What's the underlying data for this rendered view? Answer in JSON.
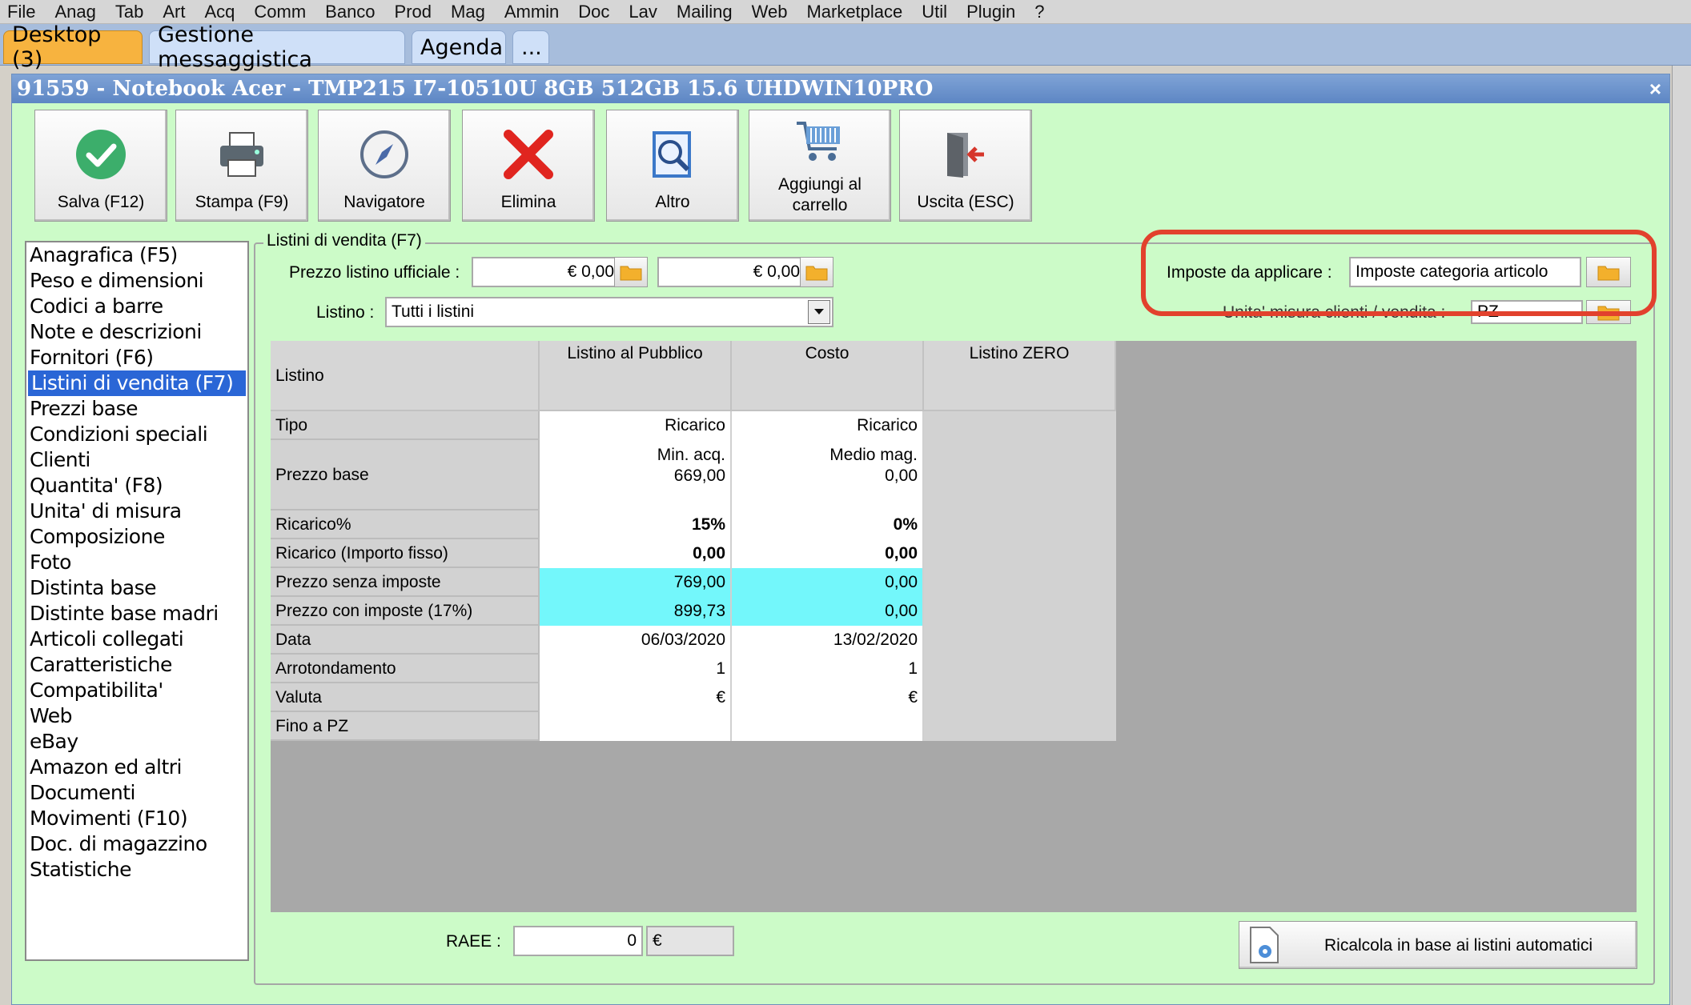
{
  "menu": [
    "File",
    "Anag",
    "Tab",
    "Art",
    "Acq",
    "Comm",
    "Banco",
    "Prod",
    "Mag",
    "Ammin",
    "Doc",
    "Lav",
    "Mailing",
    "Web",
    "Marketplace",
    "Util",
    "Plugin",
    "?"
  ],
  "tabs": [
    "Desktop (3)",
    "Gestione messaggistica",
    "Agenda",
    "..."
  ],
  "window": {
    "title": "91559 - Notebook Acer - TMP215 I7-10510U 8GB 512GB 15.6 UHDWIN10PRO",
    "close": "×"
  },
  "toolbar": {
    "save": "Salva (F12)",
    "print": "Stampa (F9)",
    "navigator": "Navigatore",
    "delete": "Elimina",
    "other": "Altro",
    "cart_line1": "Aggiungi al",
    "cart_line2": "carrello",
    "exit": "Uscita (ESC)"
  },
  "nav": [
    "Anagrafica (F5)",
    "Peso e dimensioni",
    "Codici a barre",
    "Note e descrizioni",
    "Fornitori (F6)",
    "Listini di vendita (F7)",
    "Prezzi base",
    "Condizioni speciali",
    "Clienti",
    "Quantita' (F8)",
    "Unita' di misura",
    "Composizione",
    "Foto",
    "Distinta base",
    "Distinte base madri",
    "Articoli collegati",
    "Caratteristiche",
    "Compatibilita'",
    "Web",
    "eBay",
    "Amazon ed altri",
    "Documenti",
    "Movimenti (F10)",
    "Doc. di magazzino",
    "Statistiche"
  ],
  "nav_selected": "Listini di vendita (F7)",
  "form": {
    "legend": "Listini di vendita (F7)",
    "official_price_label": "Prezzo listino ufficiale :",
    "official_price_1": "€ 0,00",
    "official_price_2": "€ 0,00",
    "listino_label": "Listino :",
    "listino_value": "Tutti i listini",
    "taxes_label": "Imposte da applicare :",
    "taxes_value": "Imposte categoria articolo",
    "um_label": "Unita' misura clienti / vendita :",
    "um_value": "PZ",
    "raee_label": "RAEE :",
    "raee_value": "0",
    "raee_currency": "€",
    "recalc_button": "Ricalcola in base ai listini automatici"
  },
  "grid": {
    "corner": "Listino",
    "columns": [
      "Listino al Pubblico",
      "Costo",
      "Listino ZERO"
    ],
    "rows": [
      {
        "label": "Tipo",
        "c1": "Ricarico",
        "c2": "Ricarico"
      },
      {
        "label": "Prezzo base",
        "c1a": "Min. acq.",
        "c1b": "669,00",
        "c2a": "Medio mag.",
        "c2b": "0,00"
      },
      {
        "label": "Ricarico%",
        "c1": "15%",
        "c2": "0%"
      },
      {
        "label": "Ricarico (Importo fisso)",
        "c1": "0,00",
        "c2": "0,00"
      },
      {
        "label": "Prezzo senza imposte",
        "c1": "769,00",
        "c2": "0,00"
      },
      {
        "label": "Prezzo con imposte (17%)",
        "c1": "899,73",
        "c2": "0,00"
      },
      {
        "label": "Data",
        "c1": "06/03/2020",
        "c2": "13/02/2020"
      },
      {
        "label": "Arrotondamento",
        "c1": "1",
        "c2": "1"
      },
      {
        "label": "Valuta",
        "c1": "€",
        "c2": "€"
      },
      {
        "label": "Fino a PZ",
        "c1": "",
        "c2": ""
      }
    ]
  },
  "colors": {
    "window_bg": "#ccfbc8",
    "title_bg": "#5d86c4",
    "selected": "#2a66d6",
    "cyan": "#73f7fb",
    "highlight": "#e2412d"
  }
}
